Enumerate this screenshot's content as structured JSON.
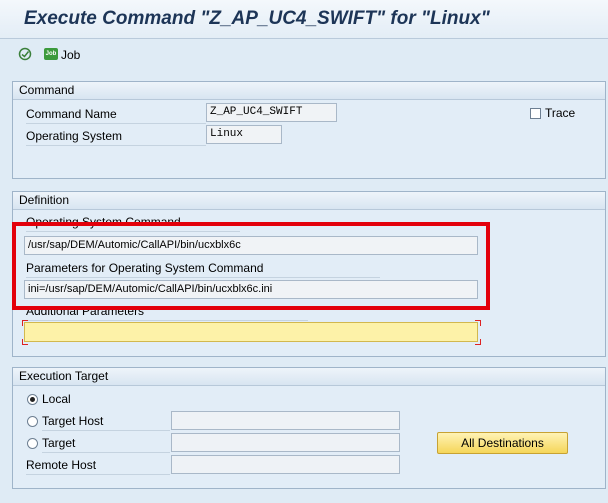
{
  "window": {
    "title": "Execute Command \"Z_AP_UC4_SWIFT\" for \"Linux\""
  },
  "toolbar": {
    "job_label": "Job",
    "job_badge": "Job"
  },
  "command_group": {
    "title": "Command",
    "command_name_label": "Command Name",
    "command_name_value": "Z_AP_UC4_SWIFT",
    "os_label": "Operating System",
    "os_value": "Linux",
    "trace_label": "Trace"
  },
  "definition_group": {
    "title": "Definition",
    "os_command_label": "Operating System Command",
    "os_command_value": "/usr/sap/DEM/Automic/CallAPI/bin/ucxblx6c",
    "params_label": "Parameters for Operating System Command",
    "params_value": "ini=/usr/sap/DEM/Automic/CallAPI/bin/ucxblx6c.ini",
    "additional_label": "Additional Parameters",
    "additional_value": ""
  },
  "execution_group": {
    "title": "Execution Target",
    "local_label": "Local",
    "target_host_label": "Target Host",
    "target_label": "Target",
    "remote_host_label": "Remote Host",
    "all_destinations_label": "All Destinations",
    "selected": "Local"
  },
  "colors": {
    "highlight": "#e3000b",
    "required_field": "#fdf2a8",
    "background": "#dfebf5"
  }
}
